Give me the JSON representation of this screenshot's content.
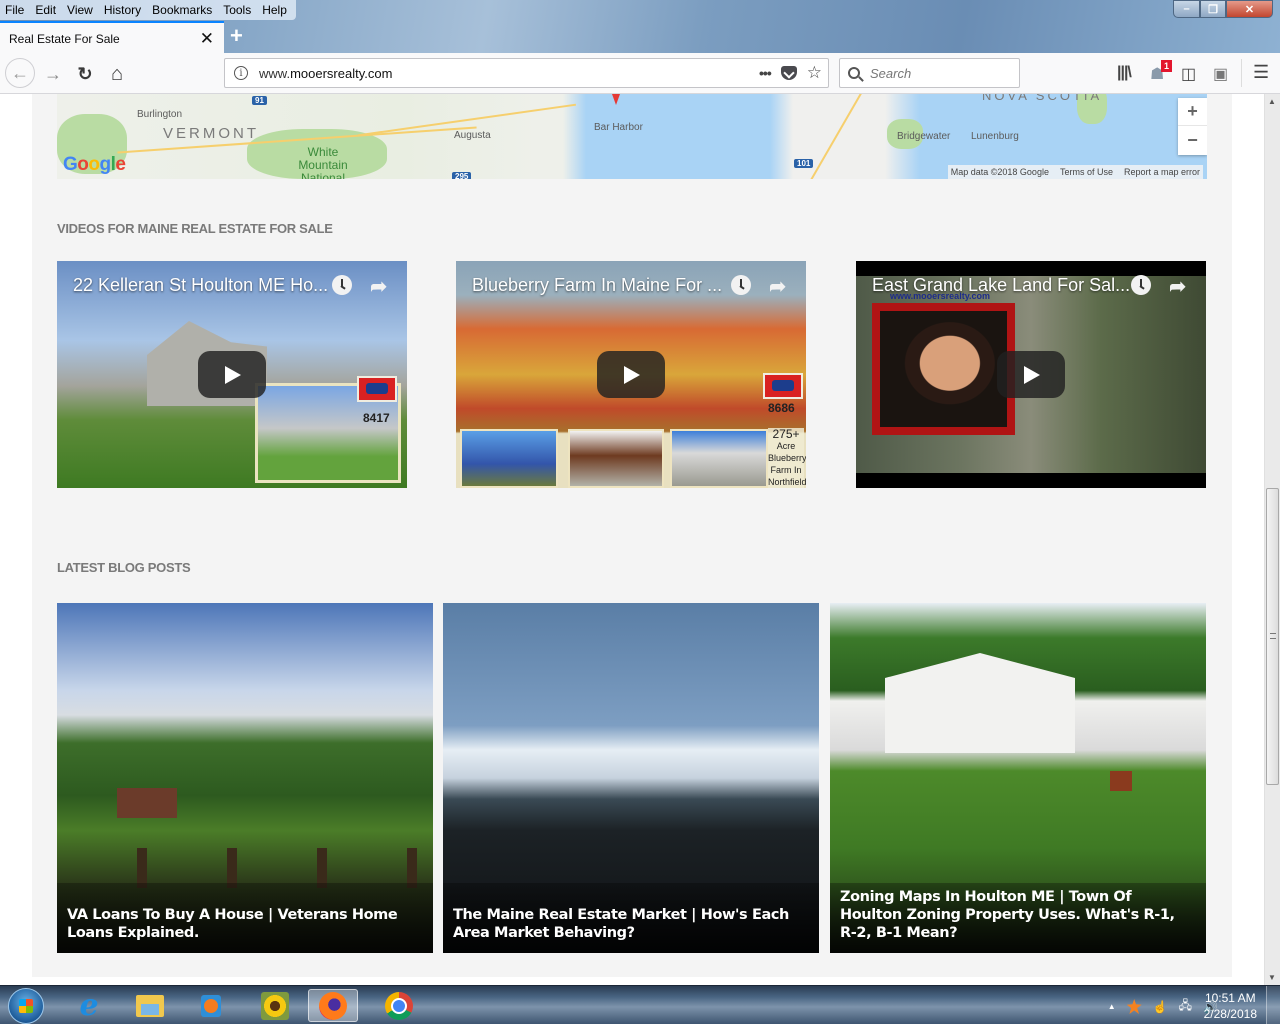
{
  "window": {
    "menu": [
      "File",
      "Edit",
      "View",
      "History",
      "Bookmarks",
      "Tools",
      "Help"
    ],
    "controls": {
      "minimize": "–",
      "maximize": "❐",
      "close": "✕"
    }
  },
  "tab": {
    "title": "Real Estate For Sale",
    "close": "✕",
    "new_tab": "+"
  },
  "navbar": {
    "back": "←",
    "forward": "→",
    "reload": "↻",
    "home": "⌂",
    "url_prefix": "www.",
    "url_host": "mooersrealty.com",
    "page_actions": "•••",
    "bookmark_star": "☆",
    "search_placeholder": "Search",
    "library": "|||\\",
    "notification_count": "1",
    "sidebar": "◫",
    "extension": "🔒",
    "menu": "☰"
  },
  "map": {
    "labels": {
      "burlington": "Burlington",
      "vermont": "VERMONT",
      "forest": "White Mountain National Forest",
      "augusta": "Augusta",
      "bar_harbor": "Bar Harbor",
      "nova_scotia": "NOVA SCOTIA",
      "bridgewater": "Bridgewater",
      "lunenburg": "Lunenburg"
    },
    "highways": [
      "91",
      "101",
      "295"
    ],
    "zoom_in": "+",
    "zoom_out": "−",
    "footer": {
      "data": "Map data ©2018 Google",
      "terms": "Terms of Use",
      "report": "Report a map error"
    },
    "logo": [
      "G",
      "o",
      "o",
      "g",
      "l",
      "e"
    ],
    "logo_colors": [
      "#4285f4",
      "#ea4335",
      "#fbbc05",
      "#4285f4",
      "#34a853",
      "#ea4335"
    ]
  },
  "videos": {
    "heading": "VIDEOS FOR MAINE REAL ESTATE FOR SALE",
    "items": [
      {
        "title": "22 Kelleran St Houlton ME Ho...",
        "listing_number": "8417"
      },
      {
        "title": "Blueberry Farm In Maine For ...",
        "listing_number": "8686",
        "caption": [
          "275+",
          "Acre",
          "Blueberry",
          "Farm In",
          "Northfield"
        ]
      },
      {
        "title": "East Grand Lake Land For Sal...",
        "watermark": "www.mooersrealty.com"
      }
    ]
  },
  "blog": {
    "heading": "LATEST BLOG POSTS",
    "posts": [
      {
        "title": "VA Loans To Buy A House | Veterans Home Loans Explained."
      },
      {
        "title": "The Maine Real Estate Market | How's Each Area Market Behaving?"
      },
      {
        "title": "Zoning Maps In Houlton ME | Town Of Houlton Zoning Property Uses. What's R-1, R-2, B-1 Mean?"
      }
    ]
  },
  "scrollbar": {
    "up": "▲",
    "down": "▼",
    "position_fraction": 0.44
  },
  "taskbar": {
    "apps": [
      "Internet Explorer",
      "File Explorer",
      "Windows Media Player",
      "Photo Viewer",
      "Firefox",
      "Chrome"
    ],
    "tray_expand": "▲",
    "time": "10:51 AM",
    "date": "2/28/2018"
  }
}
